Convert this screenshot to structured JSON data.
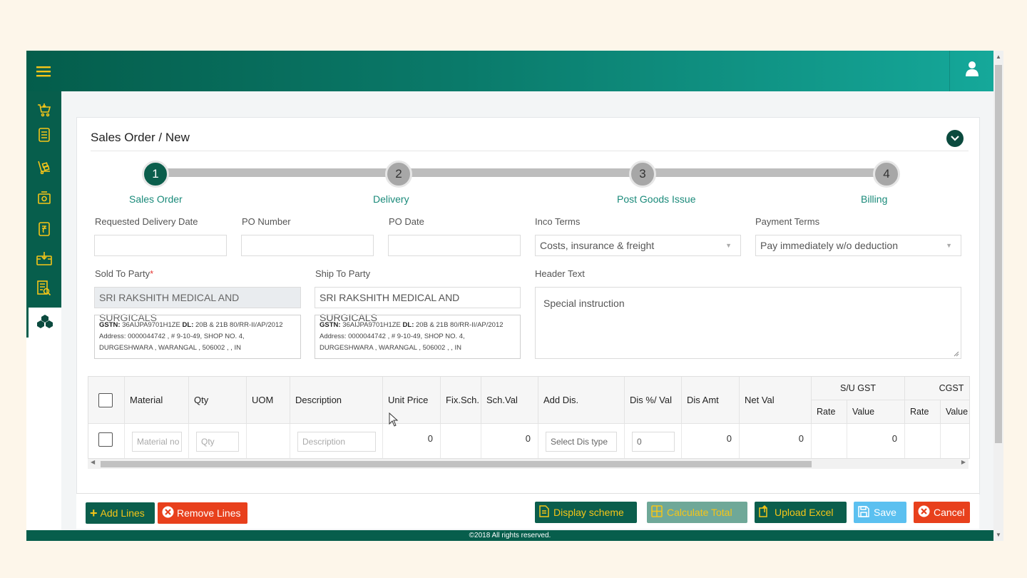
{
  "topbar": {
    "menu_icon": "hamburger-icon",
    "user_icon": "user-icon"
  },
  "sidebar": {
    "icons": [
      "cart-icon",
      "document-icon",
      "trolley-icon",
      "cash-icon",
      "receipt-icon",
      "inbox-money-icon",
      "report-search-icon",
      "boxes-icon"
    ]
  },
  "page": {
    "title": "Sales Order / New"
  },
  "steps": [
    {
      "number": "1",
      "label": "Sales Order"
    },
    {
      "number": "2",
      "label": "Delivery"
    },
    {
      "number": "3",
      "label": "Post Goods Issue"
    },
    {
      "number": "4",
      "label": "Billing"
    }
  ],
  "form": {
    "requested_delivery_date_label": "Requested Delivery Date",
    "po_number_label": "PO Number",
    "po_date_label": "PO Date",
    "inco_terms_label": "Inco Terms",
    "inco_terms_value": "Costs, insurance & freight",
    "payment_terms_label": "Payment Terms",
    "payment_terms_value": "Pay immediately w/o deduction",
    "sold_to_label": "Sold To Party",
    "required_mark": "*",
    "sold_to_value": "SRI RAKSHITH MEDICAL AND SURGICALS",
    "ship_to_label": "Ship To Party",
    "ship_to_value": "SRI RAKSHITH MEDICAL AND SURGICALS",
    "header_text_label": "Header Text",
    "header_text_value": "Special instruction",
    "address": {
      "gstn_label": "GSTN:",
      "gstn_value": "36AIJPA9701H1ZE",
      "dl_label": "DL:",
      "dl_value": "20B & 21B 80/RR-II/AP/2012",
      "line2": "Address: 0000044742 , # 9-10-49, SHOP NO. 4,",
      "line3": "DURGESHWARA , WARANGAL , 506002 , , IN"
    }
  },
  "table": {
    "headers": {
      "material": "Material",
      "qty": "Qty",
      "uom": "UOM",
      "description": "Description",
      "unit_price": "Unit Price",
      "fix_sch": "Fix.Sch.",
      "sch_val": "Sch.Val",
      "add_dis": "Add Dis.",
      "dis_pct_val": "Dis %/ Val",
      "dis_amt": "Dis Amt",
      "net_val": "Net Val",
      "su_gst": "S/U GST",
      "cgst": "CGST",
      "rate": "Rate",
      "value": "Value"
    },
    "row": {
      "material_placeholder": "Material no",
      "qty_placeholder": "Qty",
      "description_placeholder": "Description",
      "unit_price": "0",
      "sch_val": "0",
      "add_dis_placeholder": "Select Dis type",
      "dis_value": "0",
      "dis_amt": "0",
      "net_val": "0",
      "su_gst_value": "0"
    }
  },
  "buttons": {
    "add_lines": "Add Lines",
    "remove_lines": "Remove Lines",
    "display_scheme": "Display scheme",
    "calculate_total": "Calculate Total",
    "upload_excel": "Upload Excel",
    "save": "Save",
    "cancel": "Cancel"
  },
  "footer": {
    "copyright": "©2018 All rights reserved."
  },
  "colors": {
    "brand_dark": "#075e4c",
    "brand_light": "#15a89a",
    "accent": "#1a8a7a",
    "cancel": "#e8401c",
    "save": "#5bc0f0"
  }
}
